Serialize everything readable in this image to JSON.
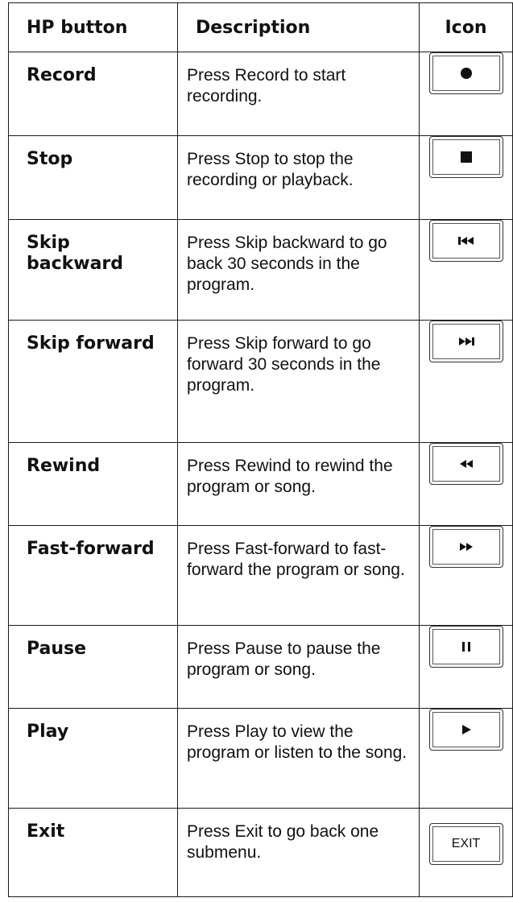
{
  "table": {
    "headers": {
      "button": "HP button",
      "description": "Description",
      "icon": "Icon"
    },
    "rows": [
      {
        "name": "Record",
        "description": "Press Record to start recording.",
        "icon": "record-icon"
      },
      {
        "name": "Stop",
        "description": "Press Stop to stop the recording or playback.",
        "icon": "stop-icon"
      },
      {
        "name": "Skip backward",
        "description": "Press Skip backward to go back 30 seconds in the program.",
        "icon": "skip-backward-icon"
      },
      {
        "name": "Skip forward",
        "description": "Press Skip forward to go forward 30 seconds in the program.",
        "icon": "skip-forward-icon"
      },
      {
        "name": "Rewind",
        "description": "Press Rewind to rewind the program or song.",
        "icon": "rewind-icon"
      },
      {
        "name": "Fast-forward",
        "description": "Press Fast-forward to fast-forward the program or song.",
        "icon": "fast-forward-icon"
      },
      {
        "name": "Pause",
        "description": "Press Pause to pause the program or song.",
        "icon": "pause-icon"
      },
      {
        "name": "Play",
        "description": "Press Play to view the program or listen to the song.",
        "icon": "play-icon"
      },
      {
        "name": "Exit",
        "description": "Press Exit to go back one submenu.",
        "icon": "exit-icon",
        "icon_label": "EXIT"
      }
    ]
  }
}
